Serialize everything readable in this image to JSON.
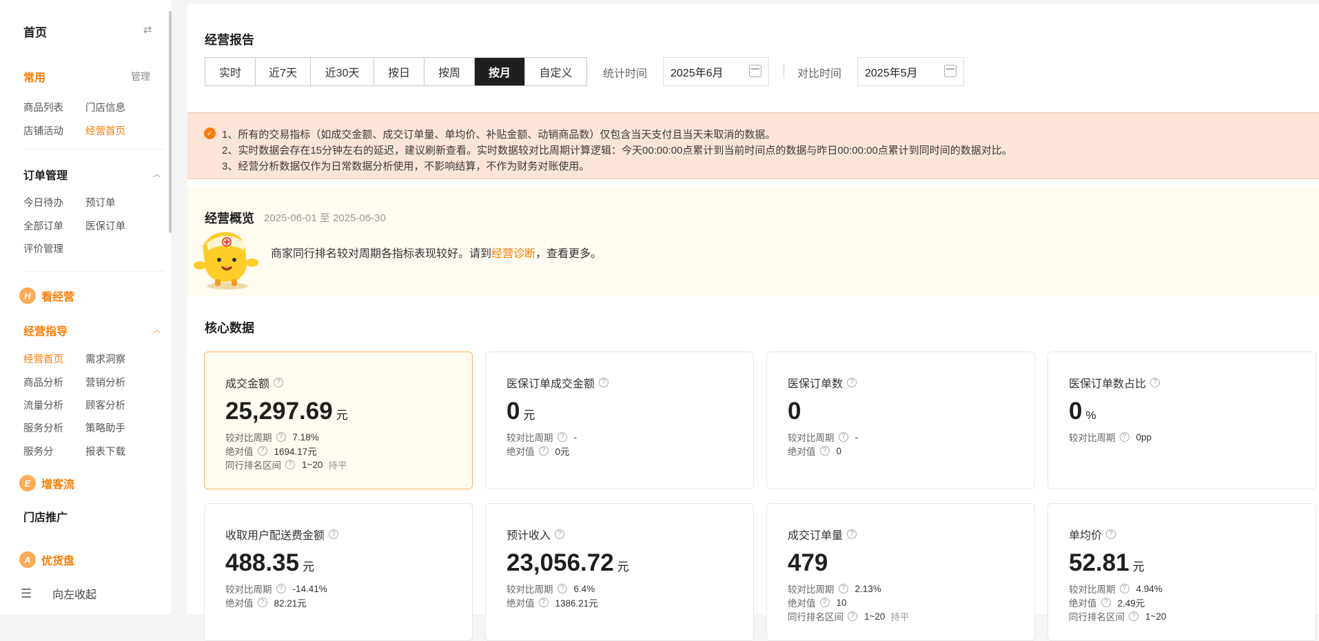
{
  "sidebar": {
    "home": "首页",
    "swap_icon": "⇄",
    "common": "常用",
    "manage": "管理",
    "common_links": [
      "商品列表",
      "门店信息",
      "店铺活动",
      "经营首页"
    ],
    "order_group": "订单管理",
    "order_links": [
      "今日待办",
      "预订单",
      "全部订单",
      "医保订单",
      "评价管理"
    ],
    "sec_business": {
      "icon": "H",
      "label": "看经营"
    },
    "guide_group": "经营指导",
    "guide_links": [
      "经营首页",
      "需求洞察",
      "商品分析",
      "营销分析",
      "流量分析",
      "顾客分析",
      "服务分析",
      "策略助手",
      "服务分",
      "报表下载"
    ],
    "sec_traffic": {
      "icon": "E",
      "label": "增客流"
    },
    "store_promo": "门店推广",
    "sec_goods": {
      "icon": "A",
      "label": "优货盘"
    },
    "collapse": "向左收起",
    "accent": "#ff7a00"
  },
  "report": {
    "title": "经营报告",
    "tabs": [
      "实时",
      "近7天",
      "近30天",
      "按日",
      "按周",
      "按月",
      "自定义"
    ],
    "active_tab": "按月",
    "stat_time_label": "统计时间",
    "stat_time_value": "2025年6月",
    "compare_time_label": "对比时间",
    "compare_time_value": "2025年5月"
  },
  "notice": {
    "lines": [
      "1、所有的交易指标（如成交金额、成交订单量、单均价、补贴金额、动销商品数）仅包含当天支付且当天未取消的数据。",
      "2、实时数据会存在15分钟左右的延迟，建议刷新查看。实时数据较对比周期计算逻辑：今天00:00:00点累计到当前时间点的数据与昨日00:00:00点累计到同时间的数据对比。",
      "3、经营分析数据仅作为日常数据分析使用，不影响结算，不作为财务对账使用。"
    ]
  },
  "overview": {
    "title": "经营概览",
    "date_range": "2025-06-01 至 2025-06-30",
    "text_before": "商家同行排名较对周期各指标表现较好。请到",
    "link": "经营诊断",
    "text_after": "，查看更多。"
  },
  "core": {
    "title": "核心数据",
    "cards": [
      {
        "title": "成交金额",
        "value": "25,297.69",
        "unit": "元",
        "rows": [
          {
            "label": "较对比周期",
            "value": "7.18%"
          },
          {
            "label": "绝对值",
            "value": "1694.17元"
          },
          {
            "label": "同行排名区间",
            "value": "1~20",
            "extra": "持平"
          }
        ]
      },
      {
        "title": "医保订单成交金额",
        "value": "0",
        "unit": "元",
        "rows": [
          {
            "label": "较对比周期",
            "value": "-"
          },
          {
            "label": "绝对值",
            "value": "0元"
          }
        ]
      },
      {
        "title": "医保订单数",
        "value": "0",
        "unit": "",
        "rows": [
          {
            "label": "较对比周期",
            "value": "-"
          },
          {
            "label": "绝对值",
            "value": "0"
          }
        ]
      },
      {
        "title": "医保订单数占比",
        "value": "0",
        "unit": "%",
        "rows": [
          {
            "label": "较对比周期",
            "value": "0pp"
          }
        ]
      },
      {
        "title": "收取用户配送费金额",
        "value": "488.35",
        "unit": "元",
        "rows": [
          {
            "label": "较对比周期",
            "value": "-14.41%"
          },
          {
            "label": "绝对值",
            "value": "82.21元"
          }
        ]
      },
      {
        "title": "预计收入",
        "value": "23,056.72",
        "unit": "元",
        "rows": [
          {
            "label": "较对比周期",
            "value": "6.4%"
          },
          {
            "label": "绝对值",
            "value": "1386.21元"
          }
        ]
      },
      {
        "title": "成交订单量",
        "value": "479",
        "unit": "",
        "rows": [
          {
            "label": "较对比周期",
            "value": "2.13%"
          },
          {
            "label": "绝对值",
            "value": "10"
          },
          {
            "label": "同行排名区间",
            "value": "1~20",
            "extra": "持平"
          }
        ]
      },
      {
        "title": "单均价",
        "value": "52.81",
        "unit": "元",
        "rows": [
          {
            "label": "较对比周期",
            "value": "4.94%"
          },
          {
            "label": "绝对值",
            "value": "2.49元"
          },
          {
            "label": "同行排名区间",
            "value": "1~20"
          }
        ]
      }
    ]
  }
}
